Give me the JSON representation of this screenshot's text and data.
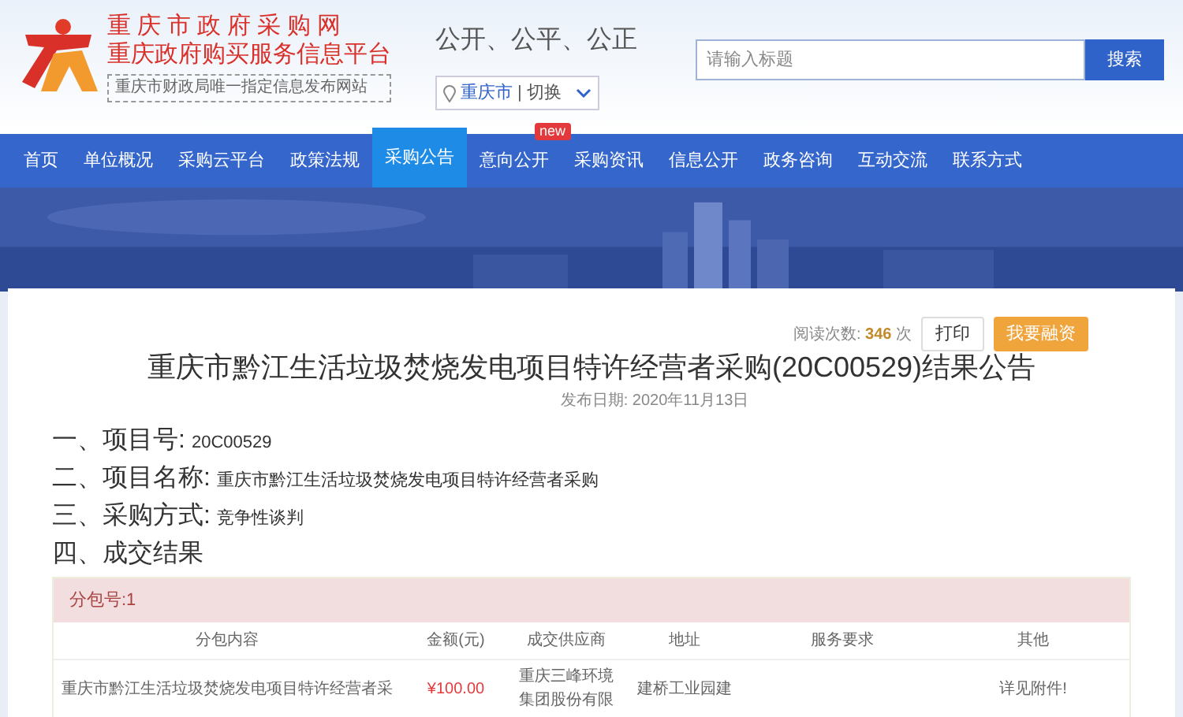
{
  "header": {
    "site_title": "重庆市政府采购网",
    "site_subtitle": "重庆政府购买服务信息平台",
    "tagline": "重庆市财政局唯一指定信息发布网站",
    "slogan": "公开、公平、公正",
    "region": {
      "city": "重庆市",
      "separator": "|",
      "switch": "切换"
    },
    "search": {
      "placeholder": "请输入标题",
      "button": "搜索"
    }
  },
  "nav": [
    {
      "label": "首页",
      "selected": false
    },
    {
      "label": "单位概况",
      "selected": false
    },
    {
      "label": "采购云平台",
      "selected": false
    },
    {
      "label": "政策法规",
      "selected": false
    },
    {
      "label": "采购公告",
      "selected": true
    },
    {
      "label": "意向公开",
      "selected": false,
      "badge": "new"
    },
    {
      "label": "采购资讯",
      "selected": false
    },
    {
      "label": "信息公开",
      "selected": false
    },
    {
      "label": "政务咨询",
      "selected": false
    },
    {
      "label": "互动交流",
      "selected": false
    },
    {
      "label": "联系方式",
      "selected": false
    }
  ],
  "article": {
    "views_label": "阅读次数:",
    "views": "346",
    "views_unit": "次",
    "print_button": "打印",
    "finance_button": "我要融资",
    "title": "重庆市黔江生活垃圾焚烧发电项目特许经营者采购(20C00529)结果公告",
    "date_label": "发布日期:",
    "date": "2020年11月13日",
    "sections": [
      {
        "heading": "一、项目号:",
        "value": "20C00529"
      },
      {
        "heading": "二、项目名称:",
        "value": "重庆市黔江生活垃圾焚烧发电项目特许经营者采购"
      },
      {
        "heading": "三、采购方式:",
        "value": "竞争性谈判"
      },
      {
        "heading": "四、成交结果"
      }
    ],
    "package": {
      "label": "分包号:1",
      "columns": [
        "分包内容",
        "金额(元)",
        "成交供应商",
        "地址",
        "服务要求",
        "其他"
      ],
      "rows": [
        [
          "重庆市黔江生活垃圾焚烧发电项目特许经营者采",
          "¥100.00",
          "重庆三峰环境集团股份有限",
          "建桥工业园建",
          "",
          "详见附件!"
        ]
      ]
    }
  }
}
